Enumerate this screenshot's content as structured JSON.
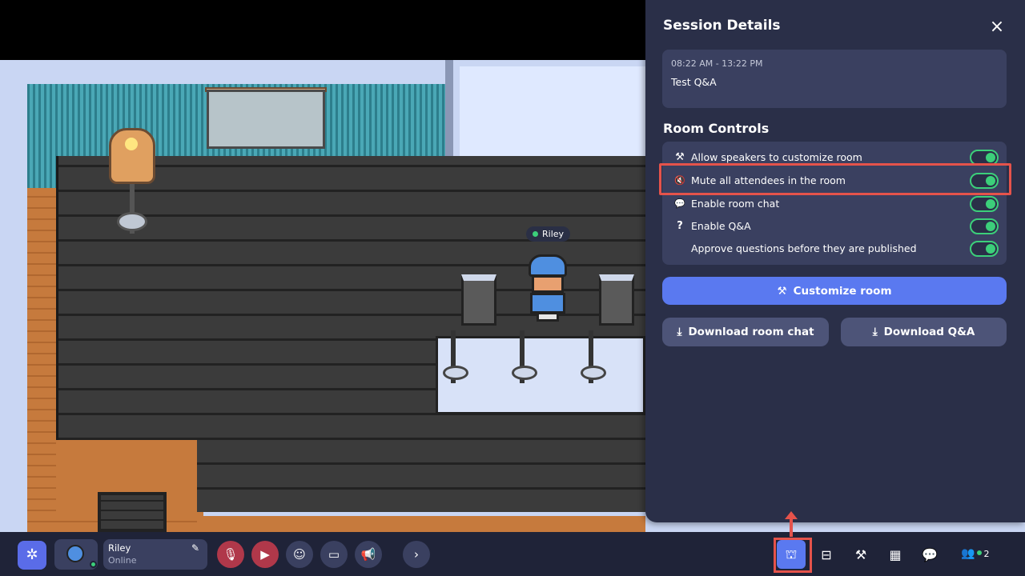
{
  "room": {
    "avatar_name": "Riley"
  },
  "panel": {
    "title": "Session Details",
    "close_icon": "×",
    "session": {
      "time": "08:22 AM - 13:22 PM",
      "name": "Test Q&A"
    },
    "controls_title": "Room Controls",
    "controls": [
      {
        "icon": "hammer-icon",
        "glyph": "⚒",
        "label": "Allow speakers to customize room",
        "enabled": true
      },
      {
        "icon": "mute-icon",
        "glyph": "🔇",
        "label": "Mute all attendees in the room",
        "enabled": true
      },
      {
        "icon": "chat-icon",
        "glyph": "💬",
        "label": "Enable room chat",
        "enabled": true
      },
      {
        "icon": "question-icon",
        "glyph": "?",
        "label": "Enable Q&A",
        "enabled": true
      },
      {
        "icon": "",
        "glyph": "",
        "label": "Approve questions before they are published",
        "enabled": true
      }
    ],
    "customize_label": "Customize room",
    "download_chat_label": "Download room chat",
    "download_qa_label": "Download Q&A"
  },
  "bottombar": {
    "user_name": "Riley",
    "user_status": "Online",
    "people_count": "2"
  },
  "colors": {
    "accent": "#5a79f0",
    "toggle_on": "#3ccf7a",
    "highlight": "#e5534b",
    "panel_bg": "#2a2f48"
  }
}
